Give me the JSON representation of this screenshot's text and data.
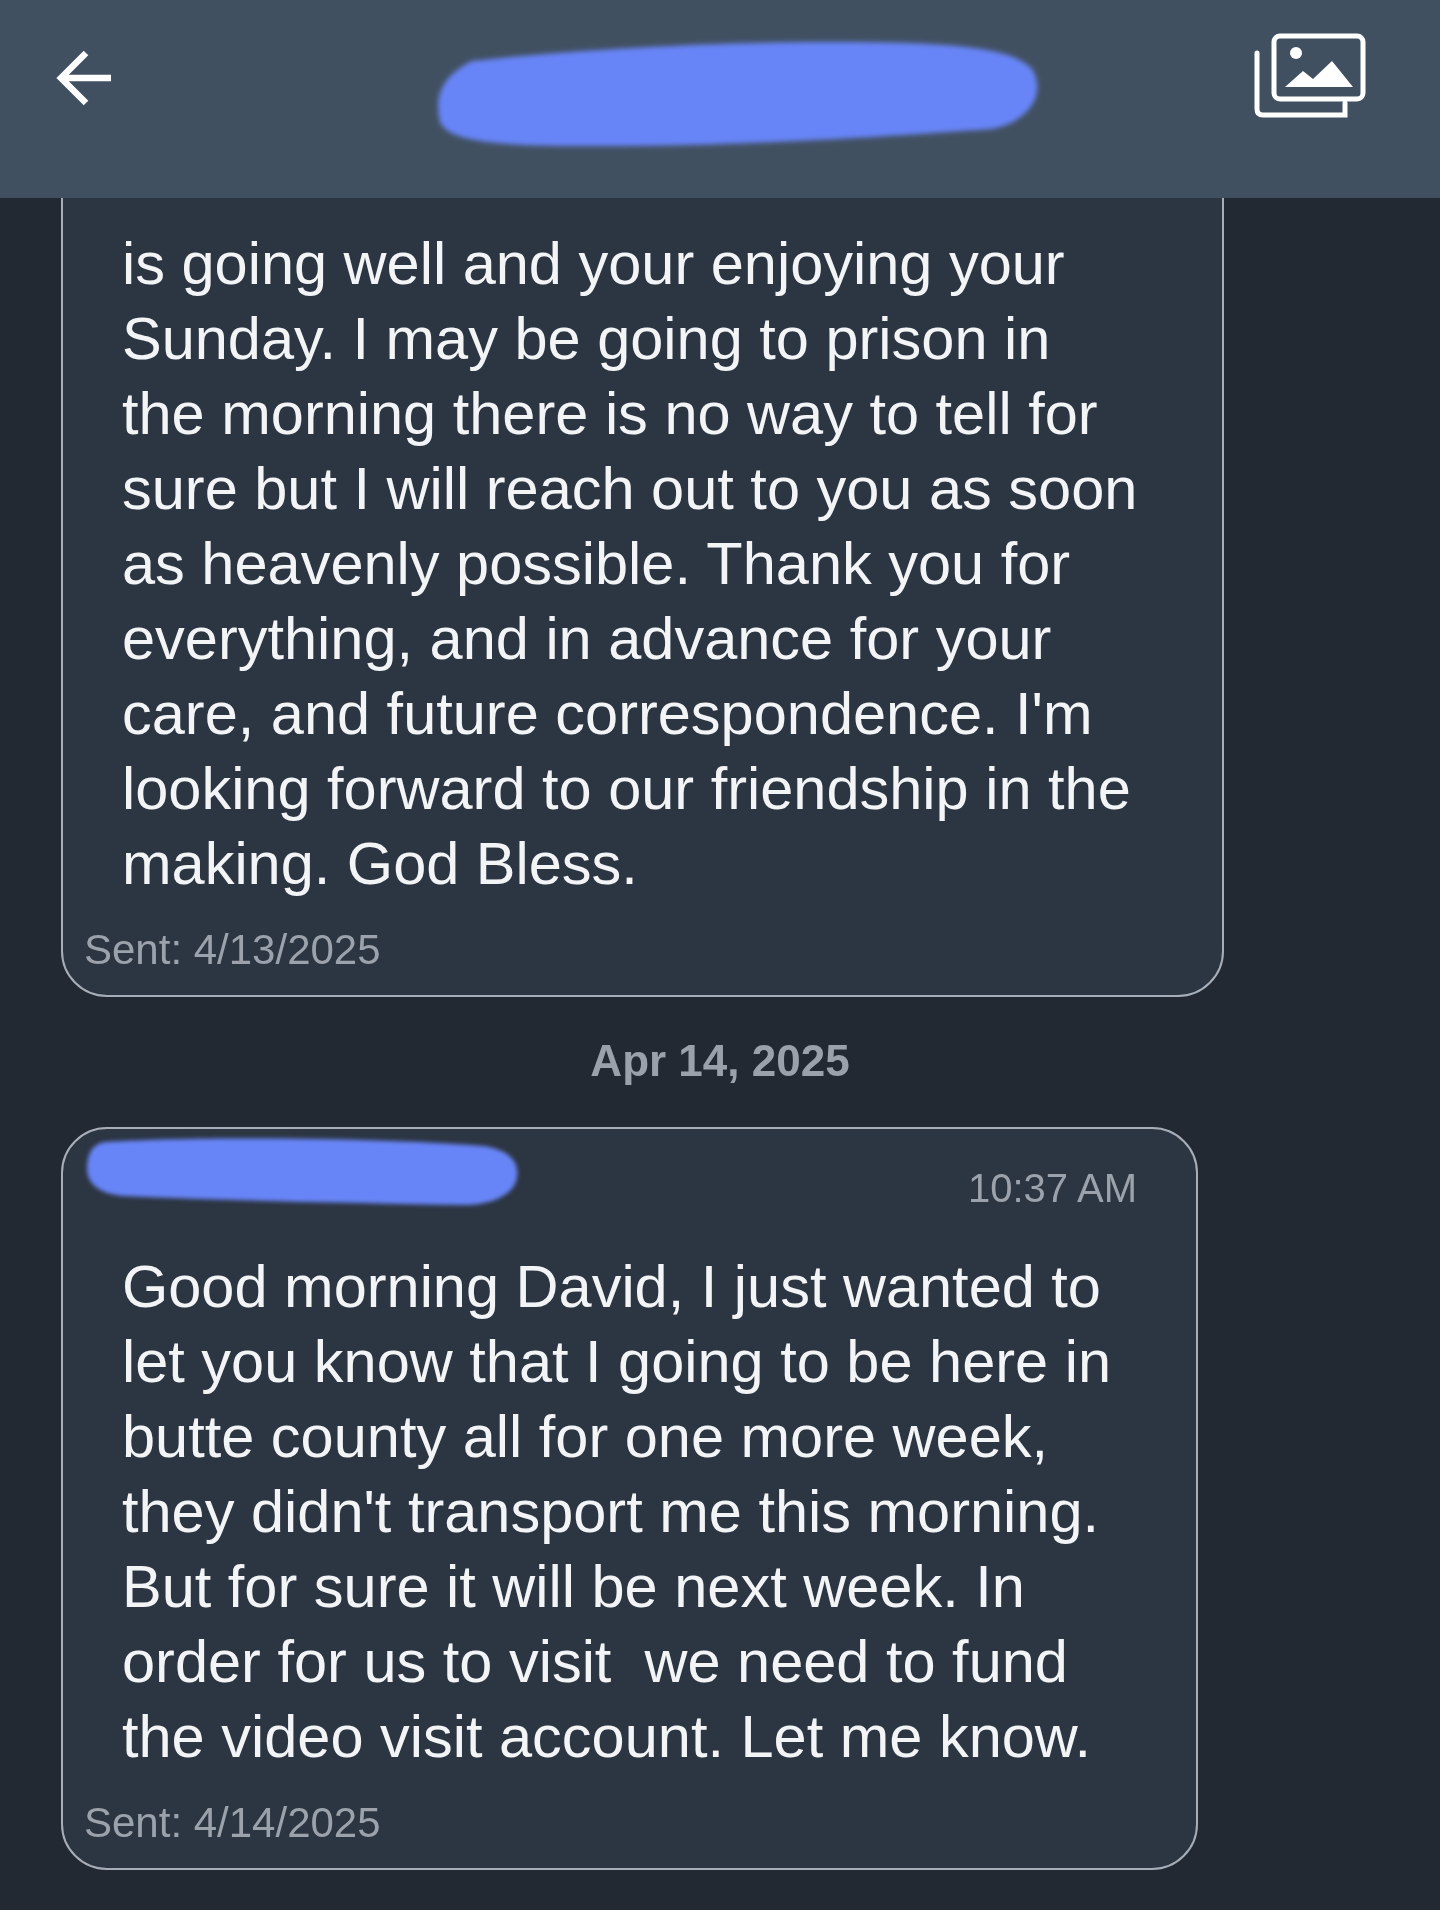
{
  "header": {
    "title_redacted": true
  },
  "thread": [
    {
      "kind": "message",
      "body": "is going well and your enjoying your\nSunday. I may be going to prison in\nthe morning there is no way to tell for\nsure but I will reach out to you as soon\nas heavenly possible. Thank you for\neverything, and in advance for your\ncare, and future correspondence. I'm\nlooking forward to our friendship in the\nmaking. God Bless.",
      "sent": "Sent: 4/13/2025"
    },
    {
      "kind": "date",
      "label": "Apr 14, 2025"
    },
    {
      "kind": "message",
      "sender_redacted": true,
      "time": "10:37 AM",
      "body": "Good morning David, I just wanted to\nlet you know that I going to be here in\nbutte county all for one more week,\nthey didn't transport me this morning.\nBut for sure it will be next week. In\norder for us to visit  we need to fund\nthe video visit account. Let me know.",
      "sent": "Sent: 4/14/2025"
    }
  ]
}
